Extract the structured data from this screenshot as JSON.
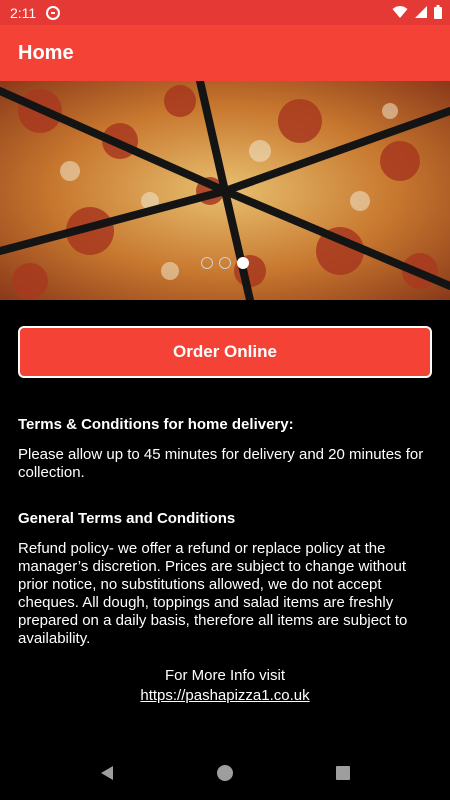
{
  "status_bar": {
    "time": "2:11",
    "icons": [
      "dnd-icon",
      "wifi-icon",
      "signal-icon",
      "battery-icon"
    ]
  },
  "app_bar": {
    "title": "Home"
  },
  "carousel": {
    "slide_count": 3,
    "active_index": 2
  },
  "order_button": {
    "label": "Order Online"
  },
  "terms_delivery": {
    "heading": "Terms & Conditions for home delivery:",
    "body": "Please allow up to 45 minutes for delivery and 20 minutes for collection."
  },
  "general_terms": {
    "heading": "General Terms and Conditions",
    "body": "Refund policy- we offer a refund or replace policy at the manager’s discretion. Prices are subject to change without prior notice, no substitutions allowed, we do not accept cheques. All dough, toppings and salad items are freshly prepared on a daily basis, therefore all items are subject to availability."
  },
  "more_info": {
    "label": "For More Info visit",
    "link": "https://pashapizza1.co.uk"
  },
  "colors": {
    "accent": "#f44336",
    "status_bar": "#e53935",
    "background": "#000000"
  },
  "nav_bar": {
    "icons": [
      "back-icon",
      "home-icon",
      "recents-icon"
    ]
  }
}
